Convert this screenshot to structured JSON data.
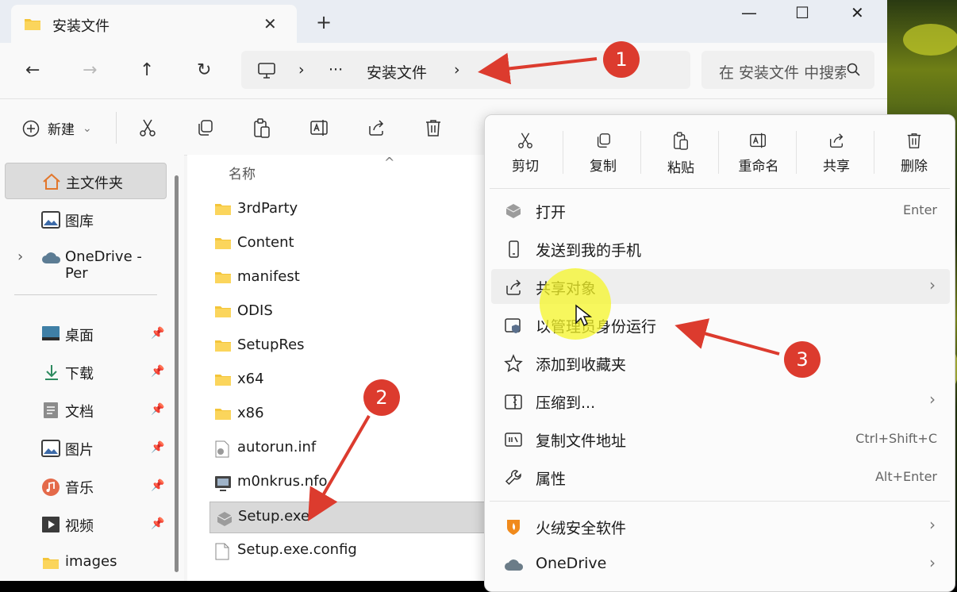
{
  "window": {
    "tab_title": "安装文件",
    "tab_close": "✕",
    "new_tab": "+",
    "minimize": "—",
    "maximize": "☐",
    "close": "✕"
  },
  "nav": {
    "back": "←",
    "forward": "→",
    "up": "↑",
    "refresh": "↻",
    "address_separator": "›",
    "address_overflow": "···",
    "address_folder": "安装文件",
    "search_placeholder": "在 安装文件 中搜索"
  },
  "toolbar": {
    "new_label": "新建",
    "new_caret": "⌄"
  },
  "sidebar": {
    "items": [
      {
        "label": "主文件夹"
      },
      {
        "label": "图库"
      },
      {
        "label": "OneDrive - Per"
      },
      {
        "label": "桌面"
      },
      {
        "label": "下载"
      },
      {
        "label": "文档"
      },
      {
        "label": "图片"
      },
      {
        "label": "音乐"
      },
      {
        "label": "视频"
      },
      {
        "label": "images"
      }
    ],
    "expand_glyph": "›",
    "pin_glyph": "📌"
  },
  "filelist": {
    "column_name": "名称",
    "sort_caret": "^",
    "rows": [
      {
        "name": "3rdParty",
        "type": "folder"
      },
      {
        "name": "Content",
        "type": "folder"
      },
      {
        "name": "manifest",
        "type": "folder"
      },
      {
        "name": "ODIS",
        "type": "folder"
      },
      {
        "name": "SetupRes",
        "type": "folder"
      },
      {
        "name": "x64",
        "type": "folder"
      },
      {
        "name": "x86",
        "type": "folder"
      },
      {
        "name": "autorun.inf",
        "type": "inf"
      },
      {
        "name": "m0nkrus.nfo",
        "type": "nfo"
      },
      {
        "name": "Setup.exe",
        "type": "exe"
      },
      {
        "name": "Setup.exe.config",
        "type": "config"
      }
    ]
  },
  "context_menu": {
    "quick_actions": [
      {
        "label": "剪切",
        "icon": "cut-icon"
      },
      {
        "label": "复制",
        "icon": "copy-icon"
      },
      {
        "label": "粘贴",
        "icon": "paste-icon"
      },
      {
        "label": "重命名",
        "icon": "rename-icon"
      },
      {
        "label": "共享",
        "icon": "share-icon"
      },
      {
        "label": "删除",
        "icon": "delete-icon"
      }
    ],
    "items": [
      {
        "label": "打开",
        "shortcut": "Enter"
      },
      {
        "label": "发送到我的手机",
        "shortcut": ""
      },
      {
        "label": "共享对象",
        "shortcut": ""
      },
      {
        "label": "以管理员身份运行",
        "shortcut": ""
      },
      {
        "label": "添加到收藏夹",
        "shortcut": ""
      },
      {
        "label": "压缩到...",
        "shortcut": ""
      },
      {
        "label": "复制文件地址",
        "shortcut": "Ctrl+Shift+C"
      },
      {
        "label": "属性",
        "shortcut": "Alt+Enter"
      },
      {
        "label": "火绒安全软件",
        "shortcut": ""
      },
      {
        "label": "OneDrive",
        "shortcut": ""
      }
    ],
    "submenu_chevron": "›"
  },
  "annotations": {
    "badge_1": "1",
    "badge_2": "2",
    "badge_3": "3",
    "color": "#dc3b2e"
  }
}
